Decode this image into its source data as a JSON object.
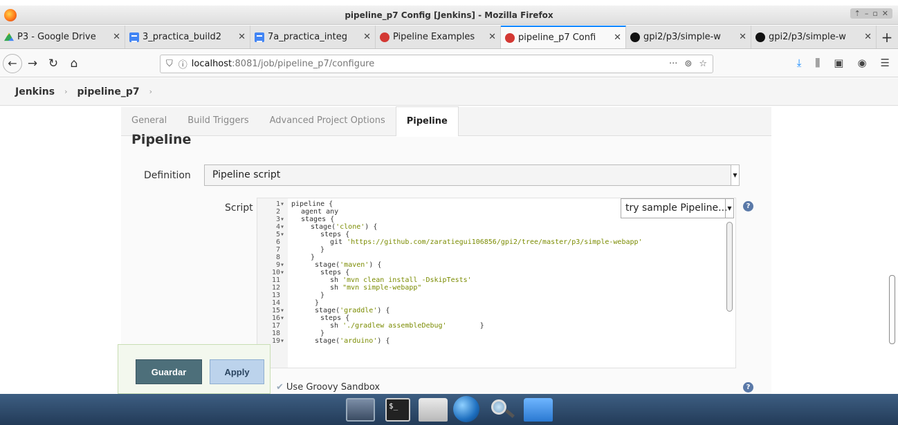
{
  "window": {
    "title": "pipeline_p7 Config [Jenkins] - Mozilla Firefox"
  },
  "tabs": [
    {
      "label": "P3 - Google Drive",
      "icon": "google-drive-icon"
    },
    {
      "label": "3_practica_build2",
      "icon": "google-docs-icon"
    },
    {
      "label": "7a_practica_integ",
      "icon": "google-docs-icon"
    },
    {
      "label": "Pipeline Examples",
      "icon": "jenkins-icon"
    },
    {
      "label": "pipeline_p7 Confi",
      "icon": "jenkins-icon",
      "active": true
    },
    {
      "label": "gpi2/p3/simple-w",
      "icon": "github-icon"
    },
    {
      "label": "gpi2/p3/simple-w",
      "icon": "github-icon"
    }
  ],
  "urlbar": {
    "host": "localhost",
    "path": ":8081/job/pipeline_p7/configure"
  },
  "breadcrumb": {
    "root": "Jenkins",
    "job": "pipeline_p7"
  },
  "config": {
    "tabs": [
      "General",
      "Build Triggers",
      "Advanced Project Options",
      "Pipeline"
    ],
    "section_title": "Pipeline",
    "definition_label": "Definition",
    "definition_value": "Pipeline script",
    "script_label": "Script",
    "sample_select": "try sample Pipeline...",
    "sandbox_label": "Use Groovy Sandbox",
    "save_label": "Guardar",
    "apply_label": "Apply"
  },
  "script_lines": [
    {
      "n": "1",
      "fold": "▾",
      "indent": 0,
      "code": "pipeline {"
    },
    {
      "n": "2",
      "fold": "",
      "indent": 1,
      "code": "agent any"
    },
    {
      "n": "3",
      "fold": "▾",
      "indent": 1,
      "code": "stages {"
    },
    {
      "n": "4",
      "fold": "▾",
      "indent": 2,
      "code": "stage(",
      "str": "'clone'",
      "tail": ") {"
    },
    {
      "n": "5",
      "fold": "▾",
      "indent": 3,
      "code": "steps {"
    },
    {
      "n": "6",
      "fold": "",
      "indent": 4,
      "code": "git ",
      "str": "'https://github.com/zaratiegui106856/gpi2/tree/master/p3/simple-webapp'"
    },
    {
      "n": "7",
      "fold": "",
      "indent": 3,
      "code": "}"
    },
    {
      "n": "8",
      "fold": "",
      "indent": 2,
      "code": "}"
    },
    {
      "n": "9",
      "fold": "▾",
      "indent": 2,
      "code": " stage(",
      "str": "'maven'",
      "tail": ") {"
    },
    {
      "n": "10",
      "fold": "▾",
      "indent": 3,
      "code": "steps {"
    },
    {
      "n": "11",
      "fold": "",
      "indent": 4,
      "code": "sh ",
      "str": "'mvn clean install -DskipTests'"
    },
    {
      "n": "12",
      "fold": "",
      "indent": 4,
      "code": "sh ",
      "str": "\"mvn simple-webapp\""
    },
    {
      "n": "13",
      "fold": "",
      "indent": 3,
      "code": "}"
    },
    {
      "n": "14",
      "fold": "",
      "indent": 2,
      "code": " }"
    },
    {
      "n": "15",
      "fold": "▾",
      "indent": 2,
      "code": " stage(",
      "str": "'graddle'",
      "tail": ") {"
    },
    {
      "n": "16",
      "fold": "▾",
      "indent": 3,
      "code": "steps {"
    },
    {
      "n": "17",
      "fold": "",
      "indent": 4,
      "code": "sh ",
      "str": "'./gradlew assembleDebug'",
      "tail": "        }"
    },
    {
      "n": "18",
      "fold": "",
      "indent": 3,
      "code": "}"
    },
    {
      "n": "19",
      "fold": "▾",
      "indent": 2,
      "code": " stage(",
      "str": "'arduino'",
      "tail": ") {"
    }
  ],
  "taskbar": [
    "desktop-app-icon",
    "terminal-app-icon",
    "home-folder-app-icon",
    "web-browser-app-icon",
    "search-app-icon",
    "file-manager-app-icon"
  ],
  "colors": {
    "accent": "#0a84ff",
    "save_button": "#4d6f7a",
    "apply_button": "#bcd3ec",
    "string": "#7a8b00"
  }
}
